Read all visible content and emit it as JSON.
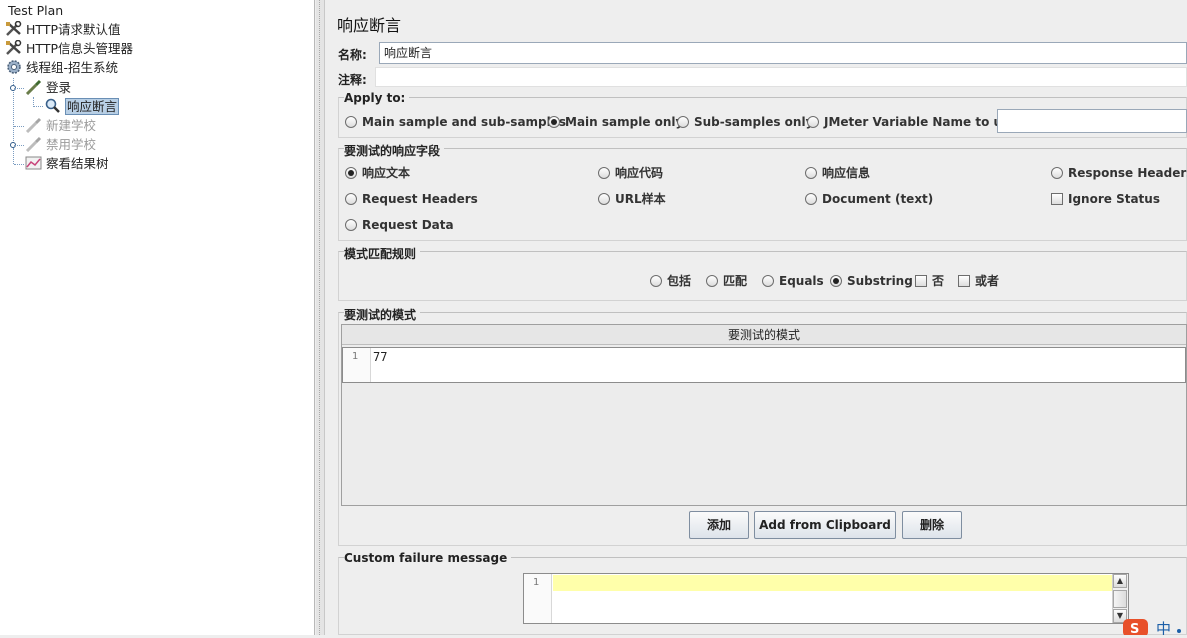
{
  "tree": {
    "root": "Test Plan",
    "items": [
      {
        "label": "HTTP请求默认值",
        "icon": "wrench-icon"
      },
      {
        "label": "HTTP信息头管理器",
        "icon": "wrench-icon"
      },
      {
        "label": "线程组-招生系统",
        "icon": "gear-icon"
      },
      {
        "label": "登录",
        "icon": "pipette-icon"
      },
      {
        "label": "响应断言",
        "icon": "magnifier-icon",
        "selected": true
      },
      {
        "label": "新建学校",
        "icon": "pipette-icon",
        "disabled": true
      },
      {
        "label": "禁用学校",
        "icon": "pipette-icon",
        "disabled": true
      },
      {
        "label": "察看结果树",
        "icon": "chart-icon"
      }
    ]
  },
  "panel": {
    "title": "响应断言",
    "name_label": "名称:",
    "name_value": "响应断言",
    "comment_label": "注释:",
    "comment_value": ""
  },
  "apply_to": {
    "title": "Apply to:",
    "options": [
      "Main sample and sub-samples",
      "Main sample only",
      "Sub-samples only",
      "JMeter Variable Name to use"
    ],
    "selected": 1,
    "variable_value": ""
  },
  "response_field": {
    "title": "要测试的响应字段",
    "options": [
      "响应文本",
      "响应代码",
      "响应信息",
      "Response Headers",
      "Request Headers",
      "URL样本",
      "Document (text)",
      "Request Data"
    ],
    "selected": 0,
    "ignore_status_label": "Ignore Status",
    "ignore_status_checked": false
  },
  "pattern_rules": {
    "title": "模式匹配规则",
    "radios": [
      "包括",
      "匹配",
      "Equals",
      "Substring"
    ],
    "selected": 3,
    "checkboxes": [
      "否",
      "或者"
    ]
  },
  "patterns": {
    "title": "要测试的模式",
    "column_header": "要测试的模式",
    "rows": [
      {
        "line": "1",
        "value": "77"
      }
    ]
  },
  "buttons": {
    "add": "添加",
    "add_clipboard": "Add from Clipboard",
    "delete": "删除"
  },
  "failure": {
    "title": "Custom failure message",
    "line": "1",
    "value": ""
  },
  "colors": {
    "selection": "#b8cfe5",
    "editor_highlight": "#ffffaa",
    "ime_accent": "#e8502a"
  }
}
